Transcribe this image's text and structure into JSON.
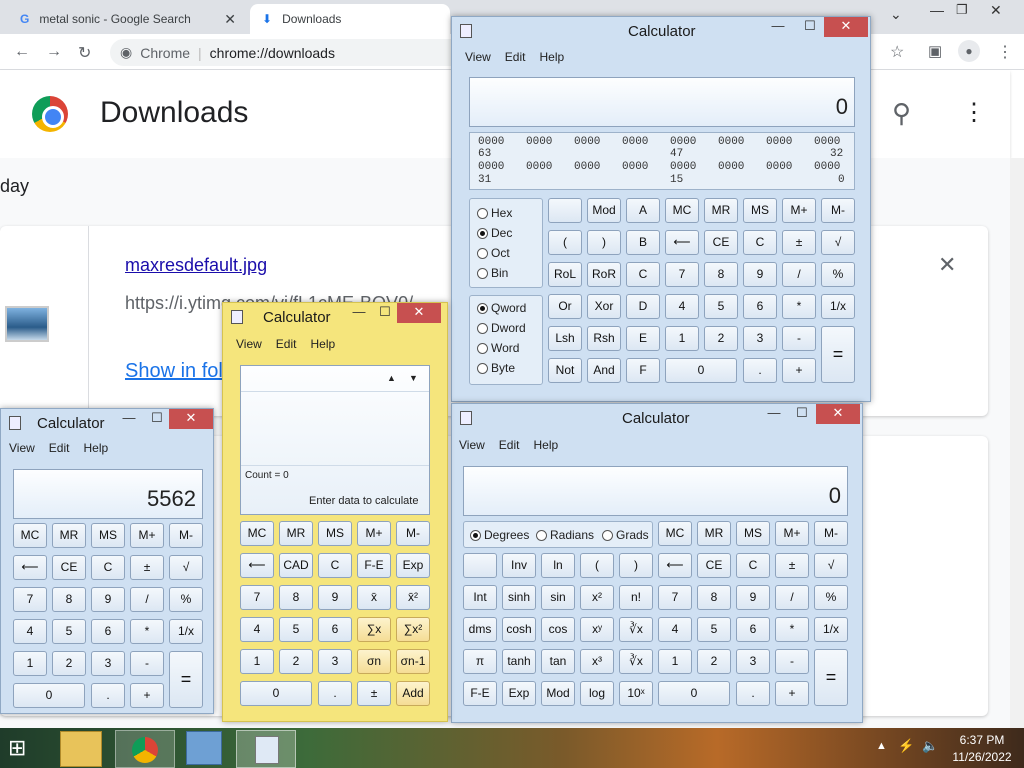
{
  "browser": {
    "tabs": [
      {
        "title": "metal sonic - Google Search",
        "close": "✕"
      },
      {
        "title": "Downloads",
        "close": "✕"
      }
    ],
    "omnibox": {
      "scheme": "Chrome",
      "separator": "|",
      "url": "chrome://downloads"
    },
    "page_title": "Downloads",
    "date_group": "day",
    "download": {
      "filename": "maxresdefault.jpg",
      "url": "https://i.ytimg.com/vi/fL1cME-BOV0/",
      "action": "Show in folder",
      "close": "✕"
    }
  },
  "calc_programmer": {
    "title": "Calculator",
    "menu": [
      "View",
      "Edit",
      "Help"
    ],
    "display": "0",
    "bits_row1": [
      "0000",
      "0000",
      "0000",
      "0000",
      "0000",
      "0000",
      "0000",
      "0000"
    ],
    "bits_labels1": [
      "63",
      "47",
      "32"
    ],
    "bits_row2": [
      "0000",
      "0000",
      "0000",
      "0000",
      "0000",
      "0000",
      "0000",
      "0000"
    ],
    "bits_labels2": [
      "31",
      "15",
      "0"
    ],
    "base": [
      "Hex",
      "Dec",
      "Oct",
      "Bin"
    ],
    "size": [
      "Qword",
      "Dword",
      "Word",
      "Byte"
    ],
    "buttons": [
      [
        "",
        "Mod",
        "A",
        "MC",
        "MR",
        "MS",
        "M+",
        "M-"
      ],
      [
        "(",
        ")",
        "B",
        "⟵",
        "CE",
        "C",
        "±",
        "√"
      ],
      [
        "RoL",
        "RoR",
        "C",
        "7",
        "8",
        "9",
        "/",
        "%"
      ],
      [
        "Or",
        "Xor",
        "D",
        "4",
        "5",
        "6",
        "*",
        "1/x"
      ],
      [
        "Lsh",
        "Rsh",
        "E",
        "1",
        "2",
        "3",
        "-",
        "="
      ],
      [
        "Not",
        "And",
        "F",
        "0",
        ".",
        "+"
      ]
    ]
  },
  "calc_statistics": {
    "title": "Calculator",
    "menu": [
      "View",
      "Edit",
      "Help"
    ],
    "count": "Count = 0",
    "hint": "Enter data to calculate",
    "buttons": [
      [
        "MC",
        "MR",
        "MS",
        "M+",
        "M-"
      ],
      [
        "⟵",
        "CAD",
        "C",
        "F-E",
        "Exp"
      ],
      [
        "7",
        "8",
        "9",
        "x̄",
        "x̄²"
      ],
      [
        "4",
        "5",
        "6",
        "∑x",
        "∑x²"
      ],
      [
        "1",
        "2",
        "3",
        "σn",
        "σn-1"
      ],
      [
        "0",
        ".",
        "±",
        "Add"
      ]
    ]
  },
  "calc_standard": {
    "title": "Calculator",
    "menu": [
      "View",
      "Edit",
      "Help"
    ],
    "display": "5562",
    "buttons": [
      [
        "MC",
        "MR",
        "MS",
        "M+",
        "M-"
      ],
      [
        "⟵",
        "CE",
        "C",
        "±",
        "√"
      ],
      [
        "7",
        "8",
        "9",
        "/",
        "%"
      ],
      [
        "4",
        "5",
        "6",
        "*",
        "1/x"
      ],
      [
        "1",
        "2",
        "3",
        "-",
        "="
      ],
      [
        "0",
        ".",
        "+"
      ]
    ]
  },
  "calc_scientific": {
    "title": "Calculator",
    "menu": [
      "View",
      "Edit",
      "Help"
    ],
    "display": "0",
    "angle": [
      "Degrees",
      "Radians",
      "Grads"
    ],
    "buttons": [
      [
        "MC",
        "MR",
        "MS",
        "M+",
        "M-"
      ],
      [
        "",
        "Inv",
        "ln",
        "(",
        ")",
        "⟵",
        "CE",
        "C",
        "±",
        "√"
      ],
      [
        "Int",
        "sinh",
        "sin",
        "x²",
        "n!",
        "7",
        "8",
        "9",
        "/",
        "%"
      ],
      [
        "dms",
        "cosh",
        "cos",
        "xʸ",
        "∛x",
        "4",
        "5",
        "6",
        "*",
        "1/x"
      ],
      [
        "π",
        "tanh",
        "tan",
        "x³",
        "∛x",
        "1",
        "2",
        "3",
        "-",
        "="
      ],
      [
        "F-E",
        "Exp",
        "Mod",
        "log",
        "10ˣ",
        "0",
        ".",
        "+"
      ]
    ]
  },
  "taskbar": {
    "apps": [
      "start-button",
      "file-explorer",
      "chrome",
      "control-panel",
      "calculator"
    ],
    "time": "6:37 PM",
    "date": "11/26/2022"
  }
}
